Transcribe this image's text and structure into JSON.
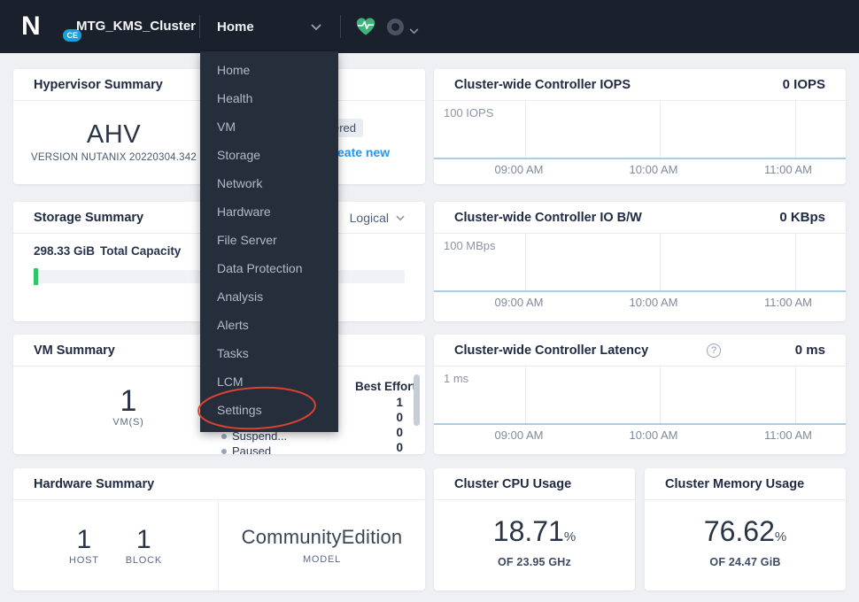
{
  "navbar": {
    "logo_letter": "N",
    "logo_badge": "CE",
    "cluster_name": "MTG_KMS_Cluster",
    "nav_dropdown_label": "Home"
  },
  "menu": {
    "items": [
      "Home",
      "Health",
      "VM",
      "Storage",
      "Network",
      "Hardware",
      "File Server",
      "Data Protection",
      "Analysis",
      "Alerts",
      "Tasks",
      "LCM",
      "Settings"
    ],
    "annotated_item": "Settings"
  },
  "cards": {
    "hypervisor": {
      "title": "Hypervisor Summary",
      "value": "AHV",
      "subtitle": "VERSION NUTANIX 20220304.342"
    },
    "partial": {
      "badge_fragment": "ered",
      "link_fragment": "eate new"
    },
    "iops": {
      "title": "Cluster-wide Controller IOPS",
      "header_value": "0 IOPS",
      "ymax_label": "100 IOPS",
      "x_labels": [
        "09:00 AM",
        "10:00 AM",
        "11:00 AM"
      ],
      "series": []
    },
    "storage": {
      "title": "Storage Summary",
      "selector_value": "Logical",
      "capacity_value": "298.33 GiB",
      "capacity_label": "Total Capacity"
    },
    "iobw": {
      "title": "Cluster-wide Controller IO B/W",
      "header_value": "0 KBps",
      "ymax_label": "100 MBps",
      "x_labels": [
        "09:00 AM",
        "10:00 AM",
        "11:00 AM"
      ],
      "series": []
    },
    "vm": {
      "title": "VM Summary",
      "count": "1",
      "count_label": "VM(S)",
      "column_header": "Best Effort",
      "column_values": [
        "1",
        "0",
        "0",
        "0"
      ],
      "visible_rows": [
        "Suspend...",
        "Paused"
      ]
    },
    "latency": {
      "title": "Cluster-wide Controller Latency",
      "header_value": "0 ms",
      "ymax_label": "1 ms",
      "help_glyph": "?",
      "x_labels": [
        "09:00 AM",
        "10:00 AM",
        "11:00 AM"
      ],
      "series": []
    },
    "hardware": {
      "title": "Hardware Summary",
      "stats": [
        {
          "value": "1",
          "label": "HOST"
        },
        {
          "value": "1",
          "label": "BLOCK"
        }
      ],
      "model_value": "CommunityEdition",
      "model_label": "MODEL"
    },
    "cpu": {
      "title": "Cluster CPU Usage",
      "value": "18.71",
      "unit": "%",
      "subtitle": "OF 23.95 GHz"
    },
    "memory": {
      "title": "Cluster Memory Usage",
      "value": "76.62",
      "unit": "%",
      "subtitle": "OF 24.47 GiB"
    }
  },
  "colors": {
    "accent_blue": "#2097f3",
    "storage_green": "#2fc568",
    "health_green": "#3db579",
    "baseline_blue": "#a8cee6",
    "annotation_red": "#d84234",
    "ce_badge_blue": "#18a0dc"
  }
}
